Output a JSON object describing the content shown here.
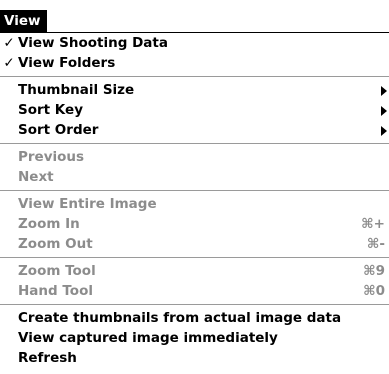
{
  "menu": {
    "title": "View",
    "groups": [
      {
        "items": [
          {
            "label": "View Shooting Data",
            "checked": true
          },
          {
            "label": "View Folders",
            "checked": true
          }
        ]
      },
      {
        "items": [
          {
            "label": "Thumbnail Size",
            "submenu": true
          },
          {
            "label": "Sort Key",
            "submenu": true
          },
          {
            "label": "Sort Order",
            "submenu": true
          }
        ]
      },
      {
        "items": [
          {
            "label": "Previous",
            "disabled": true
          },
          {
            "label": "Next",
            "disabled": true
          }
        ]
      },
      {
        "items": [
          {
            "label": "View Entire Image",
            "disabled": true
          },
          {
            "label": "Zoom In",
            "disabled": true,
            "shortcut": "⌘+"
          },
          {
            "label": "Zoom Out",
            "disabled": true,
            "shortcut": "⌘-"
          }
        ]
      },
      {
        "items": [
          {
            "label": "Zoom Tool",
            "disabled": true,
            "shortcut": "⌘9"
          },
          {
            "label": "Hand Tool",
            "disabled": true,
            "shortcut": "⌘0"
          }
        ]
      },
      {
        "items": [
          {
            "label": "Create thumbnails from actual image data"
          },
          {
            "label": "View captured image immediately"
          },
          {
            "label": "Refresh"
          }
        ]
      }
    ],
    "check_glyph": "✓",
    "colors": {
      "enabled_text": "#000000",
      "disabled_text": "#8c8c8c",
      "title_bg": "#000000",
      "title_text": "#ffffff"
    }
  }
}
